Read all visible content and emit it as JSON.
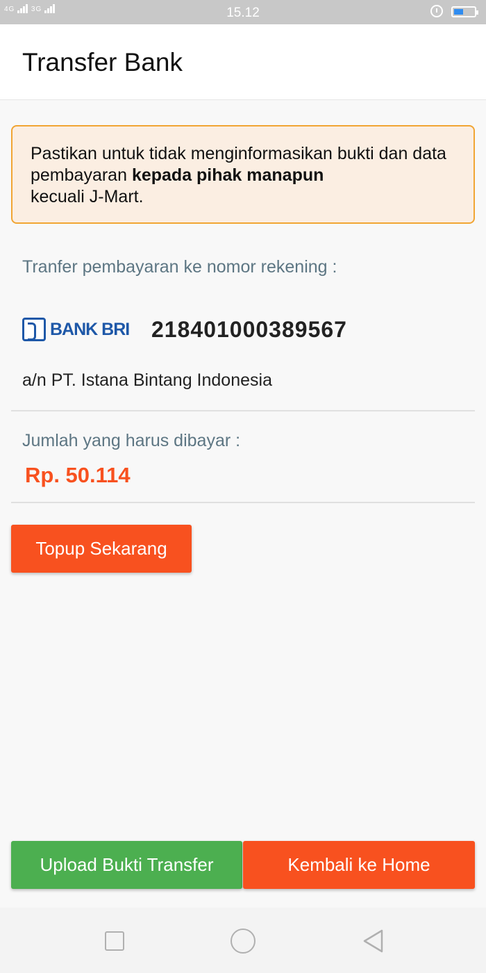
{
  "status_bar": {
    "signal_left": "4G",
    "signal_right": "3G",
    "time": "15.12",
    "battery_level": 0.45,
    "alarm_icon": "alarm-clock-icon",
    "battery_icon": "battery-icon"
  },
  "app_bar": {
    "title": "Transfer Bank"
  },
  "notice": {
    "text_before": "Pastikan untuk tidak menginformasikan bukti dan data pembayaran ",
    "text_bold": "kepada pihak manapun",
    "text_after": " kecuali J-Mart."
  },
  "transfer": {
    "label": "Tranfer pembayaran ke nomor rekening :",
    "bank_name": "BANK BRI",
    "account_number": "218401000389567",
    "account_holder": "a/n PT. Istana Bintang Indonesia"
  },
  "payment": {
    "label": "Jumlah yang harus dibayar :",
    "amount": "Rp. 50.114"
  },
  "buttons": {
    "topup": "Topup Sekarang",
    "upload": "Upload Bukti Transfer",
    "home": "Kembali ke Home"
  },
  "colors": {
    "accent_orange": "#f8511f",
    "success_green": "#4caf50",
    "bank_blue": "#1e58a8",
    "notice_border": "#f1a533",
    "notice_bg": "#fbeee2"
  },
  "nav_bar": {
    "icons": [
      "recent-apps-icon",
      "home-icon",
      "back-icon"
    ]
  }
}
